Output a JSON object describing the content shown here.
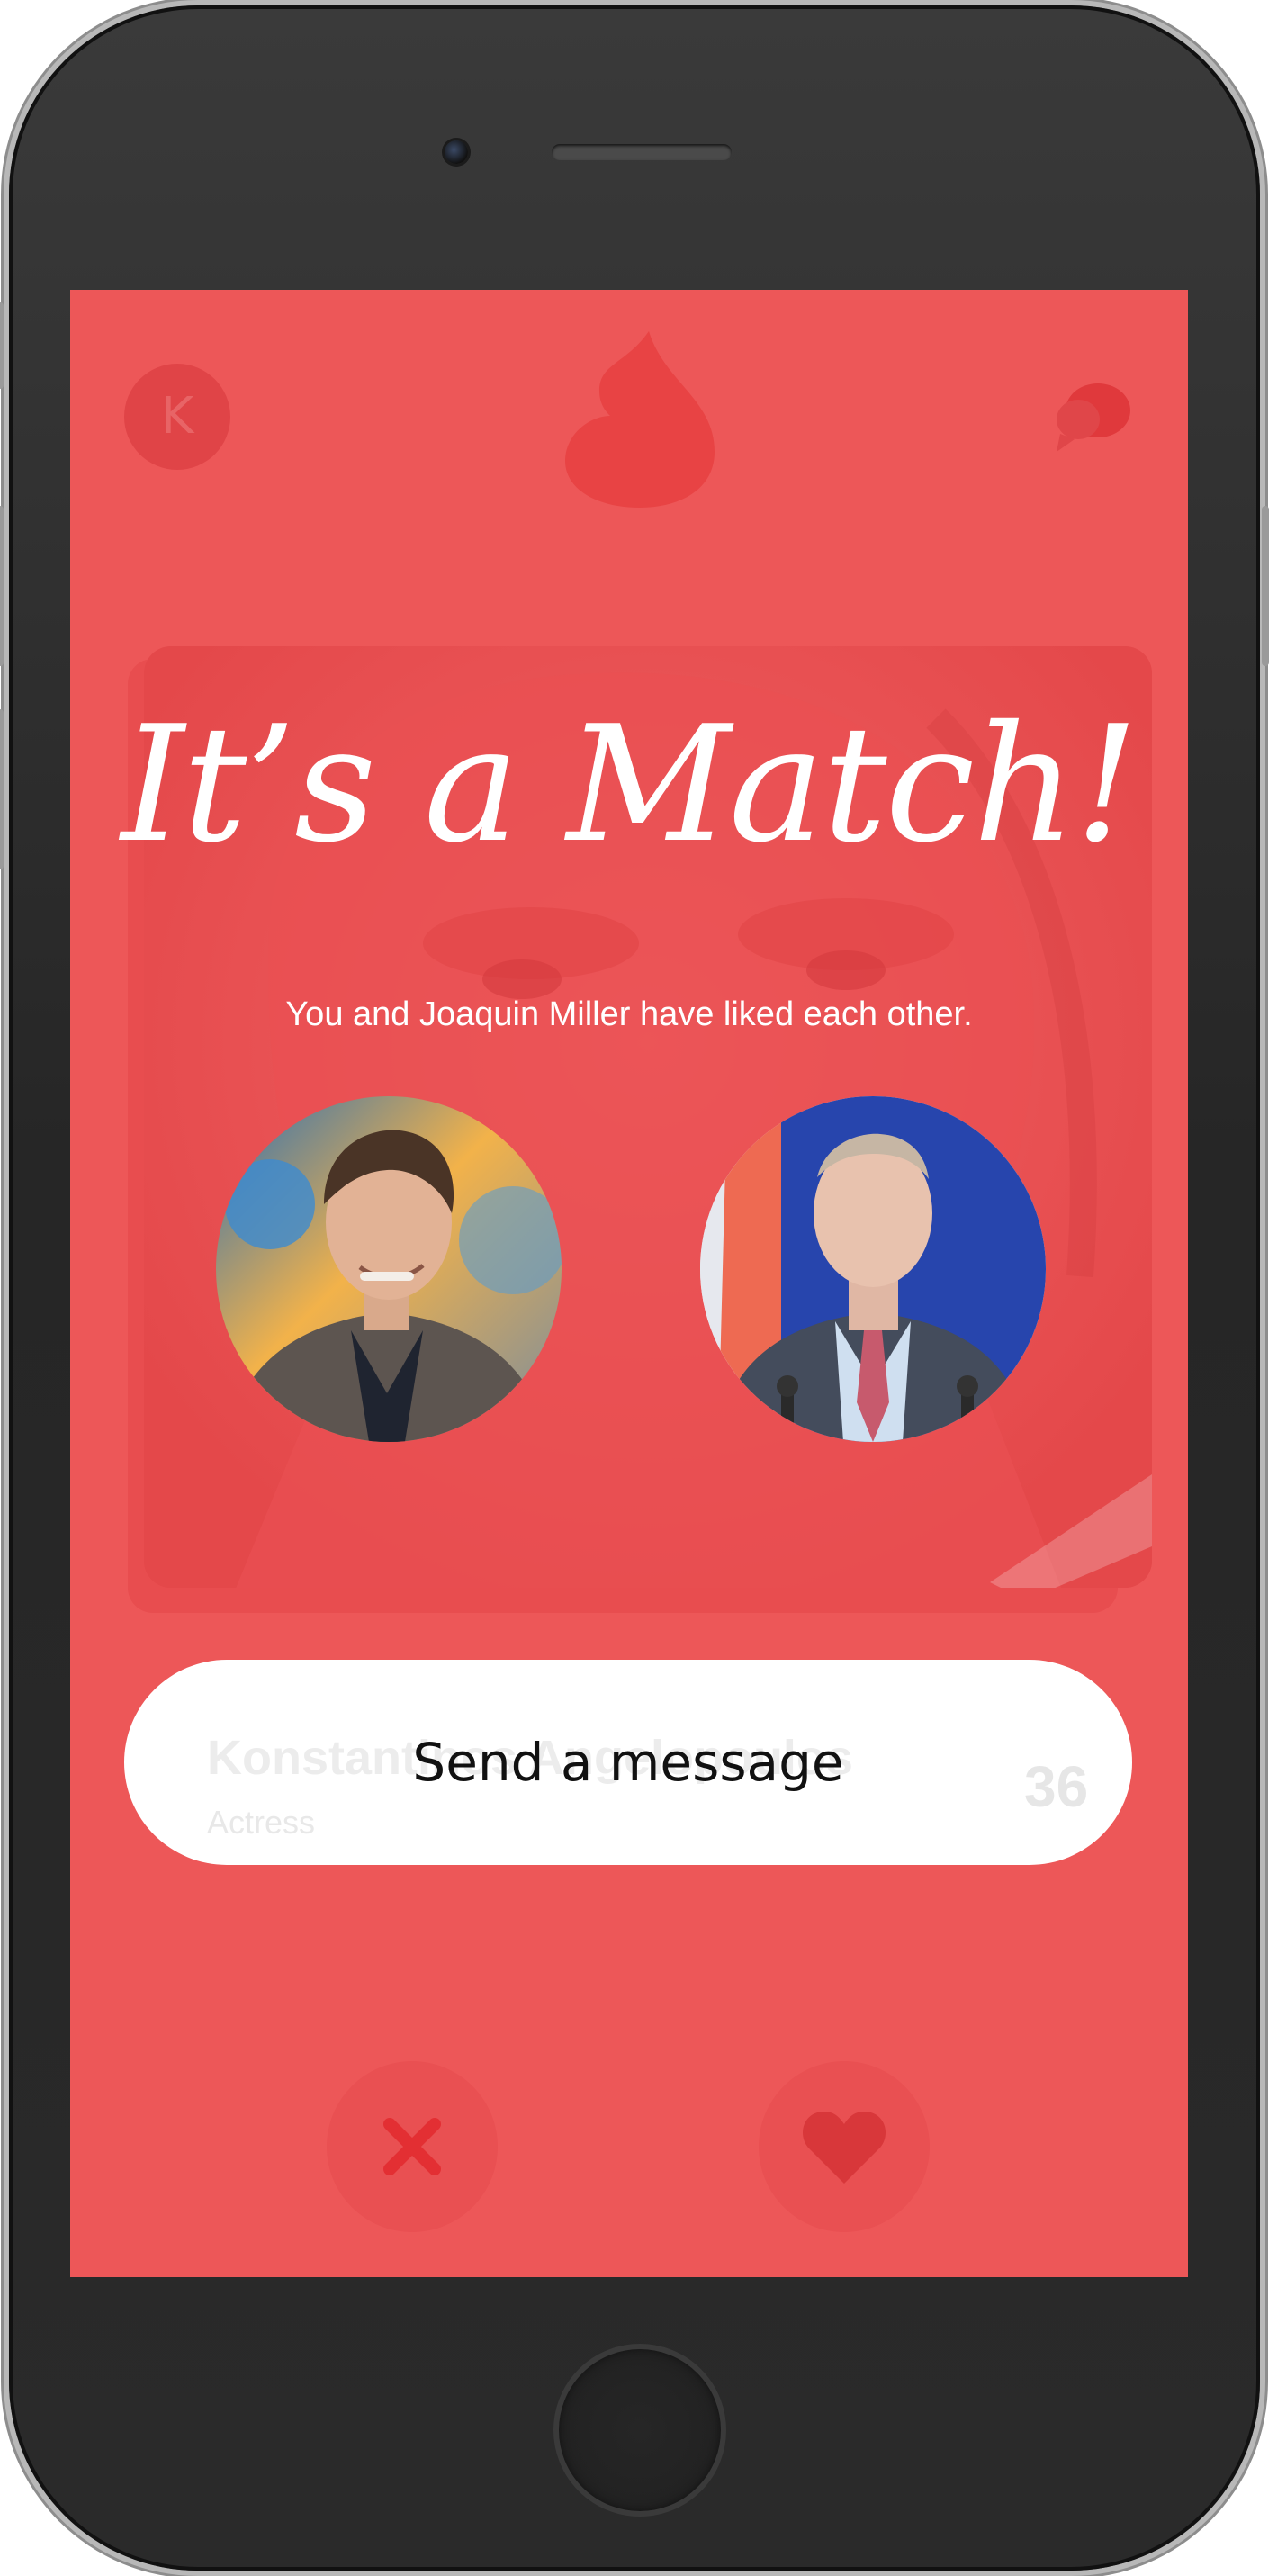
{
  "app": {
    "profile_initial": "K",
    "icons": {
      "flame": "flame-logo-icon",
      "chat": "chat-bubbles-icon",
      "dislike": "close-x-icon",
      "like": "heart-icon"
    },
    "colors": {
      "screen_background": "#ed5758",
      "overlay_text": "#ffffff",
      "button_background": "#ffffff",
      "button_text": "#111111",
      "phone_body": "#2a2a2a"
    }
  },
  "card": {
    "name": "Konstantinos Angelopoulos",
    "occupation": "Actress",
    "age": "36"
  },
  "match": {
    "title": "It’s a Match!",
    "subtitle": "You and Joaquin Miller have liked each other.",
    "send_message_label": "Send a message"
  }
}
